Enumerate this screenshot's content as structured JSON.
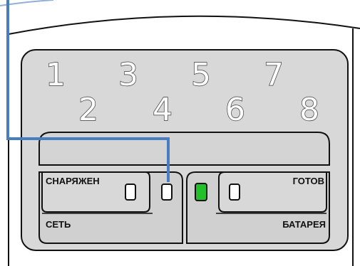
{
  "zones": [
    "1",
    "2",
    "3",
    "4",
    "5",
    "6",
    "7",
    "8"
  ],
  "buttons": {
    "armed": "СНАРЯЖЕН",
    "ready": "ГОТОВ",
    "mains": "СЕТЬ",
    "battery": "БАТАРЕЯ"
  },
  "colors": {
    "callout_line": "#4a7cc0",
    "led_on": "#22c02a",
    "led_off": "#ffffff",
    "panel": "#d8d8d8"
  }
}
